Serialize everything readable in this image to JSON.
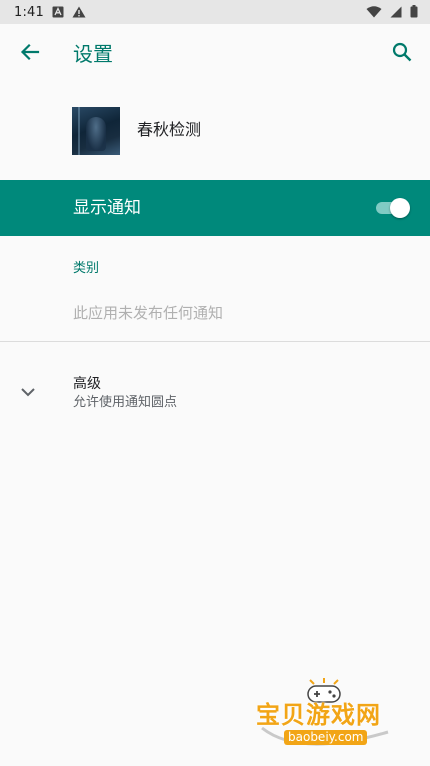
{
  "status_bar": {
    "time": "1:41",
    "icons": [
      "notification-a-icon",
      "warning-icon",
      "wifi-icon",
      "signal-icon",
      "battery-icon"
    ]
  },
  "app_bar": {
    "title": "设置",
    "back_icon": "arrow-back-icon",
    "search_icon": "search-icon"
  },
  "app_header": {
    "name": "春秋检测"
  },
  "show_notifications": {
    "label": "显示通知",
    "enabled": true
  },
  "category": {
    "header": "类别",
    "empty_text": "此应用未发布任何通知"
  },
  "advanced": {
    "title": "高级",
    "summary": "允许使用通知圆点"
  },
  "watermark": {
    "name": "宝贝游戏网",
    "url": "baobeiy.com"
  },
  "colors": {
    "accent": "#00796b",
    "bar": "#00897b",
    "toggle_track": "#80cbc4",
    "watermark": "#f2a516"
  }
}
